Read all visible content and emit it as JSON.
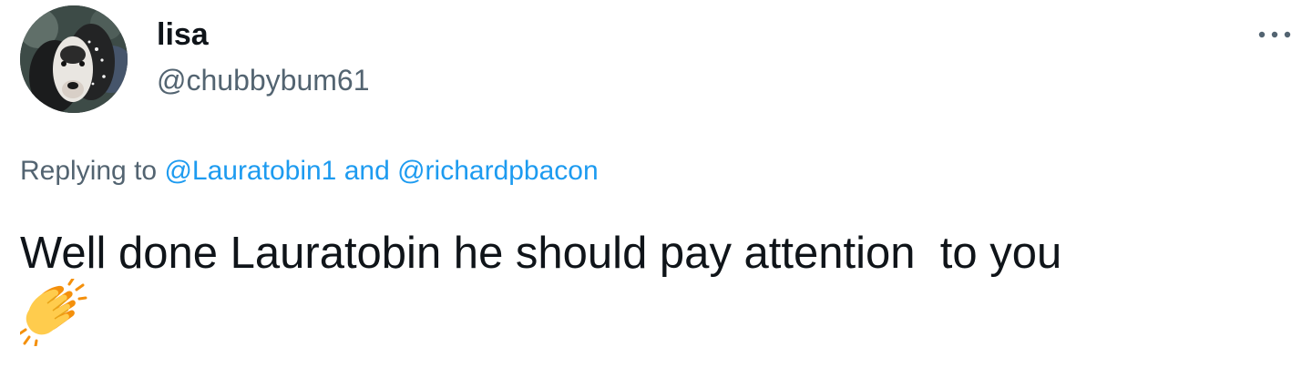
{
  "author": {
    "display_name": "lisa",
    "handle": "@chubbybum61",
    "avatar_icon": "dog-avatar"
  },
  "menu": {
    "more_icon": "more-horizontal-icon"
  },
  "reply": {
    "prefix": "Replying to ",
    "mention_1": "@Lauratobin1",
    "conjunction": " and ",
    "mention_2": "@richardpbacon"
  },
  "tweet": {
    "text": "Well done Lauratobin he should pay attention  to you",
    "emoji_icon": "clapping-hands-emoji"
  },
  "colors": {
    "text_primary": "#0f1419",
    "text_secondary": "#536471",
    "link": "#1d9bf0",
    "emoji_yellow": "#ffcc4d",
    "emoji_orange": "#f4900c"
  }
}
